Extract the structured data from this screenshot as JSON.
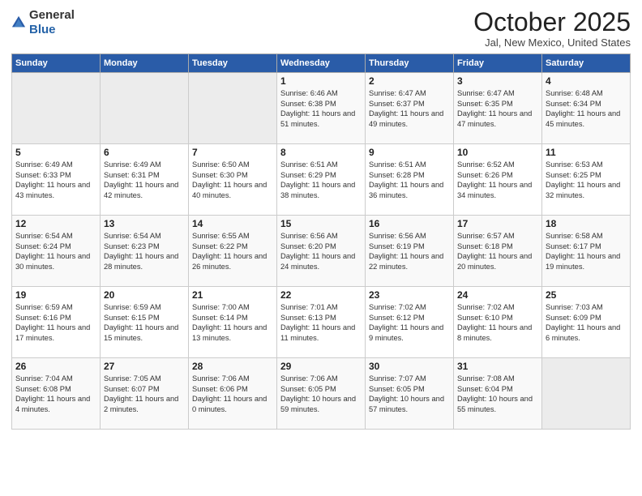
{
  "logo": {
    "general": "General",
    "blue": "Blue"
  },
  "title": "October 2025",
  "location": "Jal, New Mexico, United States",
  "headers": [
    "Sunday",
    "Monday",
    "Tuesday",
    "Wednesday",
    "Thursday",
    "Friday",
    "Saturday"
  ],
  "weeks": [
    [
      {
        "day": "",
        "empty": true
      },
      {
        "day": "",
        "empty": true
      },
      {
        "day": "",
        "empty": true
      },
      {
        "day": "1",
        "sunrise": "6:46 AM",
        "sunset": "6:38 PM",
        "daylight": "11 hours and 51 minutes."
      },
      {
        "day": "2",
        "sunrise": "6:47 AM",
        "sunset": "6:37 PM",
        "daylight": "11 hours and 49 minutes."
      },
      {
        "day": "3",
        "sunrise": "6:47 AM",
        "sunset": "6:35 PM",
        "daylight": "11 hours and 47 minutes."
      },
      {
        "day": "4",
        "sunrise": "6:48 AM",
        "sunset": "6:34 PM",
        "daylight": "11 hours and 45 minutes."
      }
    ],
    [
      {
        "day": "5",
        "sunrise": "6:49 AM",
        "sunset": "6:33 PM",
        "daylight": "11 hours and 43 minutes."
      },
      {
        "day": "6",
        "sunrise": "6:49 AM",
        "sunset": "6:31 PM",
        "daylight": "11 hours and 42 minutes."
      },
      {
        "day": "7",
        "sunrise": "6:50 AM",
        "sunset": "6:30 PM",
        "daylight": "11 hours and 40 minutes."
      },
      {
        "day": "8",
        "sunrise": "6:51 AM",
        "sunset": "6:29 PM",
        "daylight": "11 hours and 38 minutes."
      },
      {
        "day": "9",
        "sunrise": "6:51 AM",
        "sunset": "6:28 PM",
        "daylight": "11 hours and 36 minutes."
      },
      {
        "day": "10",
        "sunrise": "6:52 AM",
        "sunset": "6:26 PM",
        "daylight": "11 hours and 34 minutes."
      },
      {
        "day": "11",
        "sunrise": "6:53 AM",
        "sunset": "6:25 PM",
        "daylight": "11 hours and 32 minutes."
      }
    ],
    [
      {
        "day": "12",
        "sunrise": "6:54 AM",
        "sunset": "6:24 PM",
        "daylight": "11 hours and 30 minutes."
      },
      {
        "day": "13",
        "sunrise": "6:54 AM",
        "sunset": "6:23 PM",
        "daylight": "11 hours and 28 minutes."
      },
      {
        "day": "14",
        "sunrise": "6:55 AM",
        "sunset": "6:22 PM",
        "daylight": "11 hours and 26 minutes."
      },
      {
        "day": "15",
        "sunrise": "6:56 AM",
        "sunset": "6:20 PM",
        "daylight": "11 hours and 24 minutes."
      },
      {
        "day": "16",
        "sunrise": "6:56 AM",
        "sunset": "6:19 PM",
        "daylight": "11 hours and 22 minutes."
      },
      {
        "day": "17",
        "sunrise": "6:57 AM",
        "sunset": "6:18 PM",
        "daylight": "11 hours and 20 minutes."
      },
      {
        "day": "18",
        "sunrise": "6:58 AM",
        "sunset": "6:17 PM",
        "daylight": "11 hours and 19 minutes."
      }
    ],
    [
      {
        "day": "19",
        "sunrise": "6:59 AM",
        "sunset": "6:16 PM",
        "daylight": "11 hours and 17 minutes."
      },
      {
        "day": "20",
        "sunrise": "6:59 AM",
        "sunset": "6:15 PM",
        "daylight": "11 hours and 15 minutes."
      },
      {
        "day": "21",
        "sunrise": "7:00 AM",
        "sunset": "6:14 PM",
        "daylight": "11 hours and 13 minutes."
      },
      {
        "day": "22",
        "sunrise": "7:01 AM",
        "sunset": "6:13 PM",
        "daylight": "11 hours and 11 minutes."
      },
      {
        "day": "23",
        "sunrise": "7:02 AM",
        "sunset": "6:12 PM",
        "daylight": "11 hours and 9 minutes."
      },
      {
        "day": "24",
        "sunrise": "7:02 AM",
        "sunset": "6:10 PM",
        "daylight": "11 hours and 8 minutes."
      },
      {
        "day": "25",
        "sunrise": "7:03 AM",
        "sunset": "6:09 PM",
        "daylight": "11 hours and 6 minutes."
      }
    ],
    [
      {
        "day": "26",
        "sunrise": "7:04 AM",
        "sunset": "6:08 PM",
        "daylight": "11 hours and 4 minutes."
      },
      {
        "day": "27",
        "sunrise": "7:05 AM",
        "sunset": "6:07 PM",
        "daylight": "11 hours and 2 minutes."
      },
      {
        "day": "28",
        "sunrise": "7:06 AM",
        "sunset": "6:06 PM",
        "daylight": "11 hours and 0 minutes."
      },
      {
        "day": "29",
        "sunrise": "7:06 AM",
        "sunset": "6:05 PM",
        "daylight": "10 hours and 59 minutes."
      },
      {
        "day": "30",
        "sunrise": "7:07 AM",
        "sunset": "6:05 PM",
        "daylight": "10 hours and 57 minutes."
      },
      {
        "day": "31",
        "sunrise": "7:08 AM",
        "sunset": "6:04 PM",
        "daylight": "10 hours and 55 minutes."
      },
      {
        "day": "",
        "empty": true
      }
    ]
  ]
}
